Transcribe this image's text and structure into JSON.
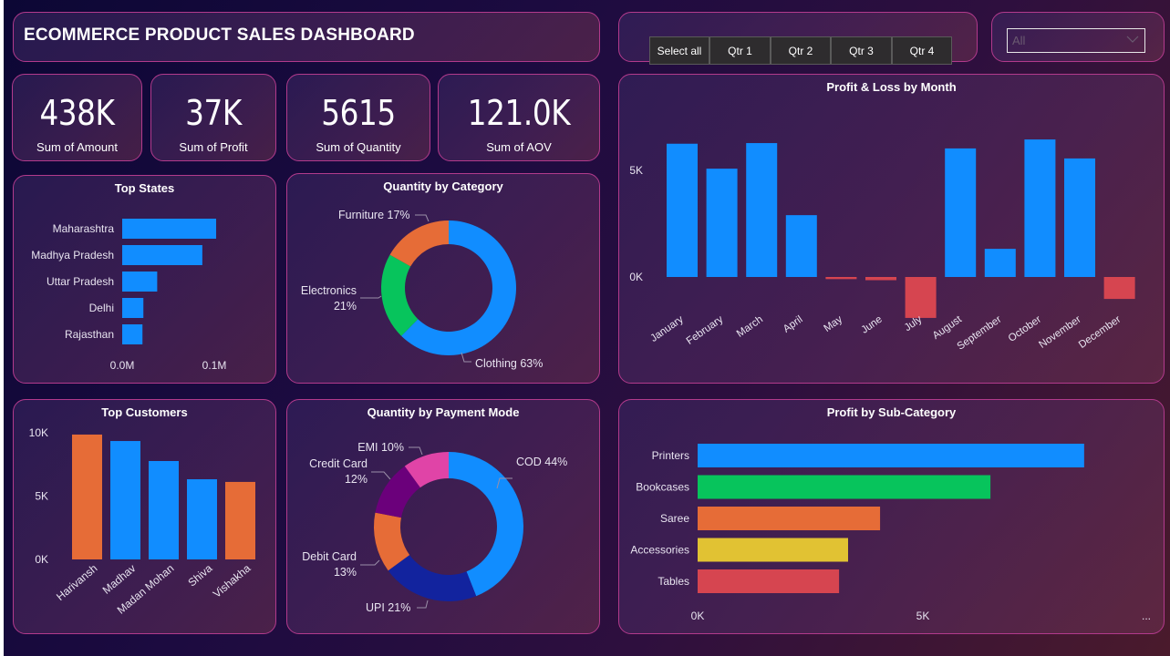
{
  "header": {
    "title": "ECOMMERCE PRODUCT SALES DASHBOARD"
  },
  "quarter_slicer": {
    "buttons": [
      "Select all",
      "Qtr 1",
      "Qtr 2",
      "Qtr 3",
      "Qtr 4"
    ]
  },
  "dropdown": {
    "value": "All",
    "icon": "chevron-down-icon"
  },
  "kpis": [
    {
      "value": "438K",
      "label": "Sum of Amount"
    },
    {
      "value": "37K",
      "label": "Sum of Profit"
    },
    {
      "value": "5615",
      "label": "Sum of Quantity"
    },
    {
      "value": "121.0K",
      "label": "Sum of AOV"
    }
  ],
  "colors": {
    "blue": "#118DFF",
    "orange": "#E66C37",
    "green": "#07C45C",
    "red": "#D64550",
    "yellow": "#E1C233",
    "navy": "#12239E",
    "purple": "#6B007B",
    "pink": "#E044A7",
    "border": "#B23A8C"
  },
  "chart_data": [
    {
      "id": "top_states",
      "type": "bar",
      "orientation": "horizontal",
      "title": "Top States",
      "categories": [
        "Maharashtra",
        "Madhya Pradesh",
        "Uttar Pradesh",
        "Delhi",
        "Rajasthan"
      ],
      "values": [
        0.102,
        0.087,
        0.038,
        0.023,
        0.022
      ],
      "unit": "M",
      "xticks": [
        "0.0M",
        "0.1M"
      ],
      "xtick_values": [
        0,
        0.1
      ],
      "xlim": [
        0,
        0.1
      ],
      "color": "#118DFF"
    },
    {
      "id": "quantity_by_category",
      "type": "pie",
      "donut": true,
      "title": "Quantity by Category",
      "slices": [
        {
          "label": "Clothing",
          "value": 63,
          "color": "#118DFF",
          "text": "Clothing 63%"
        },
        {
          "label": "Electronics",
          "value": 21,
          "color": "#07C45C",
          "text": "Electronics 21%"
        },
        {
          "label": "Furniture",
          "value": 17,
          "color": "#E66C37",
          "text": "Furniture 17%"
        }
      ]
    },
    {
      "id": "profit_loss_by_month",
      "type": "bar",
      "title": "Profit & Loss by Month",
      "categories": [
        "January",
        "February",
        "March",
        "April",
        "May",
        "June",
        "July",
        "August",
        "September",
        "October",
        "November",
        "December"
      ],
      "values": [
        6.25,
        5.08,
        6.28,
        2.9,
        -0.1,
        -0.15,
        -1.92,
        6.03,
        1.32,
        6.45,
        5.56,
        -1.03
      ],
      "unit": "K",
      "yticks": [
        "0K",
        "5K"
      ],
      "ytick_values": [
        0,
        5
      ],
      "ylim": [
        -3,
        8
      ],
      "positive_color": "#118DFF",
      "negative_color": "#D64550"
    },
    {
      "id": "top_customers",
      "type": "bar",
      "title": "Top Customers",
      "categories": [
        "Harivansh",
        "Madhav",
        "Madan Mohan",
        "Shiva",
        "Vishakha"
      ],
      "values": [
        9.86,
        9.35,
        7.77,
        6.33,
        6.12
      ],
      "colors": [
        "#E66C37",
        "#118DFF",
        "#118DFF",
        "#118DFF",
        "#E66C37"
      ],
      "unit": "K",
      "yticks": [
        "0K",
        "5K",
        "10K"
      ],
      "ytick_values": [
        0,
        5,
        10
      ],
      "ylim": [
        0,
        10
      ]
    },
    {
      "id": "quantity_by_payment_mode",
      "type": "pie",
      "donut": true,
      "title": "Quantity by Payment Mode",
      "slices": [
        {
          "label": "COD",
          "value": 44,
          "color": "#118DFF",
          "text": "COD 44%"
        },
        {
          "label": "UPI",
          "value": 21,
          "color": "#12239E",
          "text": "UPI 21%"
        },
        {
          "label": "Debit Card",
          "value": 13,
          "color": "#E66C37",
          "text": "Debit Card 13%"
        },
        {
          "label": "Credit Card",
          "value": 12,
          "color": "#6B007B",
          "text": "Credit Card 12%"
        },
        {
          "label": "EMI",
          "value": 10,
          "color": "#E044A7",
          "text": "EMI 10%"
        }
      ]
    },
    {
      "id": "profit_by_subcategory",
      "type": "bar",
      "orientation": "horizontal",
      "title": "Profit by Sub-Category",
      "categories": [
        "Printers",
        "Bookcases",
        "Saree",
        "Accessories",
        "Tables"
      ],
      "values": [
        8.58,
        6.5,
        4.05,
        3.34,
        3.14
      ],
      "colors": [
        "#118DFF",
        "#07C45C",
        "#E66C37",
        "#E1C233",
        "#D64550"
      ],
      "unit": "K",
      "xticks": [
        "0K",
        "5K"
      ],
      "xtick_values": [
        0,
        5
      ],
      "xlim": [
        0,
        10
      ],
      "more_label": "..."
    }
  ]
}
